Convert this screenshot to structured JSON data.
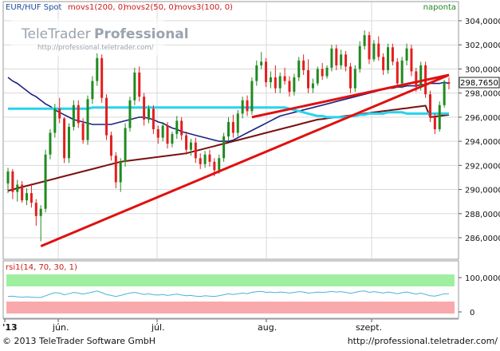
{
  "header": {
    "instrument": "EUR/HUF Spot",
    "ma1": "movs1(200, 0)",
    "ma2": "movs2(50, 0)",
    "ma3": "movs3(100, 0)",
    "period": "naponta"
  },
  "watermark": {
    "brand_light": "TeleTrader",
    "brand_bold": "Professional",
    "url": "http://professional.teletrader.com/"
  },
  "colors": {
    "up_candle": "#1f8a1f",
    "down_candle": "#e41e1e",
    "trendline": "#e01010",
    "ma_navy": "#1a2380",
    "ma_cyan": "#27d3ec",
    "ma_maroon": "#7a1010",
    "grid": "#d9d9d9",
    "rsi_line": "#46b6d4",
    "rsi_overbought": "#9ef0a0",
    "rsi_oversold": "#f9a9ab"
  },
  "price_axis": {
    "ticks": [
      "304,0000",
      "302,0000",
      "300,0000",
      "298,0000",
      "296,0000",
      "294,0000",
      "292,0000",
      "290,0000",
      "288,0000",
      "286,0000"
    ],
    "last_value": "298,7650"
  },
  "rsi": {
    "label": "rsi1(14, 70, 30, 1)",
    "ticks": [
      "100,0000",
      "0"
    ]
  },
  "x_axis": {
    "labels": [
      "'13",
      "jún.",
      "júl.",
      "aug.",
      "szept."
    ]
  },
  "footer": {
    "copyright": "© 2013 TeleTrader Software GmbH",
    "url": "http://professional.teletrader.com/"
  },
  "chart_data": {
    "type": "candlestick",
    "ylim": [
      284,
      305
    ],
    "candles_ohlc": [
      [
        290.5,
        291.8,
        289.7,
        291.5
      ],
      [
        291.5,
        291.7,
        289.2,
        289.8
      ],
      [
        289.8,
        290.8,
        289.0,
        290.4
      ],
      [
        290.4,
        290.7,
        288.9,
        289.1
      ],
      [
        289.1,
        290.1,
        288.7,
        289.7
      ],
      [
        289.7,
        290.5,
        288.5,
        288.9
      ],
      [
        288.9,
        289.2,
        287.0,
        287.8
      ],
      [
        287.8,
        288.7,
        285.7,
        288.4
      ],
      [
        288.4,
        293.3,
        288.1,
        292.9
      ],
      [
        292.9,
        295.0,
        292.5,
        294.7
      ],
      [
        294.7,
        297.1,
        294.3,
        296.7
      ],
      [
        296.7,
        297.6,
        295.5,
        295.9
      ],
      [
        295.9,
        296.0,
        292.2,
        292.6
      ],
      [
        292.6,
        295.5,
        292.2,
        295.2
      ],
      [
        295.2,
        297.4,
        294.9,
        297.0
      ],
      [
        297.0,
        297.4,
        295.1,
        295.5
      ],
      [
        295.5,
        295.9,
        293.8,
        294.1
      ],
      [
        294.1,
        297.8,
        293.7,
        297.5
      ],
      [
        297.5,
        299.4,
        297.1,
        299.0
      ],
      [
        299.0,
        301.3,
        298.6,
        300.9
      ],
      [
        300.9,
        301.2,
        297.2,
        297.6
      ],
      [
        297.6,
        297.9,
        294.1,
        294.5
      ],
      [
        294.5,
        294.8,
        292.4,
        292.8
      ],
      [
        292.8,
        293.1,
        290.1,
        290.6
      ],
      [
        290.6,
        292.6,
        289.8,
        292.3
      ],
      [
        292.3,
        295.5,
        291.9,
        295.1
      ],
      [
        295.1,
        297.7,
        294.8,
        297.4
      ],
      [
        297.4,
        300.1,
        297.0,
        299.7
      ],
      [
        299.7,
        300.2,
        297.3,
        297.7
      ],
      [
        297.7,
        298.0,
        295.3,
        295.8
      ],
      [
        295.8,
        297.0,
        295.5,
        296.7
      ],
      [
        296.7,
        297.0,
        294.6,
        295.0
      ],
      [
        295.0,
        295.3,
        293.8,
        294.3
      ],
      [
        294.3,
        295.6,
        294.0,
        295.3
      ],
      [
        295.3,
        295.6,
        293.4,
        293.8
      ],
      [
        293.8,
        294.8,
        293.5,
        294.6
      ],
      [
        294.6,
        296.1,
        294.2,
        295.7
      ],
      [
        295.7,
        296.0,
        294.1,
        294.5
      ],
      [
        294.5,
        294.8,
        292.9,
        293.3
      ],
      [
        293.3,
        294.2,
        292.8,
        293.9
      ],
      [
        293.9,
        294.3,
        292.2,
        292.6
      ],
      [
        292.6,
        293.0,
        291.7,
        292.1
      ],
      [
        292.1,
        293.2,
        291.8,
        292.9
      ],
      [
        292.9,
        293.3,
        291.9,
        292.3
      ],
      [
        292.3,
        292.6,
        291.1,
        291.6
      ],
      [
        291.6,
        292.9,
        291.3,
        292.6
      ],
      [
        292.6,
        294.7,
        292.3,
        294.4
      ],
      [
        294.4,
        296.0,
        294.0,
        295.6
      ],
      [
        295.6,
        296.2,
        294.3,
        294.7
      ],
      [
        294.7,
        296.6,
        294.4,
        296.3
      ],
      [
        296.3,
        297.7,
        295.9,
        297.4
      ],
      [
        297.4,
        297.8,
        296.1,
        296.5
      ],
      [
        296.5,
        299.3,
        296.2,
        299.0
      ],
      [
        299.0,
        300.7,
        298.6,
        300.3
      ],
      [
        300.3,
        301.4,
        300.0,
        300.6
      ],
      [
        300.6,
        300.9,
        298.5,
        298.9
      ],
      [
        298.9,
        299.8,
        298.4,
        299.3
      ],
      [
        299.3,
        300.3,
        298.0,
        298.4
      ],
      [
        298.4,
        299.7,
        298.0,
        299.4
      ],
      [
        299.4,
        300.1,
        298.7,
        299.0
      ],
      [
        299.0,
        299.4,
        297.7,
        298.1
      ],
      [
        298.1,
        299.6,
        297.8,
        299.3
      ],
      [
        299.3,
        301.0,
        299.0,
        300.7
      ],
      [
        300.7,
        301.2,
        299.5,
        299.9
      ],
      [
        299.9,
        300.8,
        298.0,
        298.4
      ],
      [
        298.4,
        299.2,
        298.0,
        298.8
      ],
      [
        298.8,
        300.2,
        298.6,
        300.0
      ],
      [
        300.0,
        300.5,
        299.1,
        299.4
      ],
      [
        299.4,
        300.3,
        299.2,
        300.1
      ],
      [
        300.1,
        302.0,
        299.8,
        301.7
      ],
      [
        301.7,
        302.0,
        299.9,
        300.3
      ],
      [
        300.3,
        301.6,
        300.0,
        301.2
      ],
      [
        301.2,
        301.5,
        299.8,
        300.2
      ],
      [
        300.2,
        300.5,
        298.0,
        298.4
      ],
      [
        298.4,
        300.3,
        298.1,
        300.0
      ],
      [
        300.0,
        302.3,
        299.7,
        301.9
      ],
      [
        301.9,
        303.2,
        301.6,
        302.8
      ],
      [
        302.8,
        303.1,
        300.4,
        300.8
      ],
      [
        300.8,
        302.4,
        300.6,
        302.1
      ],
      [
        302.1,
        302.7,
        300.7,
        301.0
      ],
      [
        301.0,
        301.3,
        299.5,
        299.9
      ],
      [
        299.9,
        302.1,
        299.6,
        301.8
      ],
      [
        301.8,
        302.1,
        300.3,
        300.6
      ],
      [
        300.6,
        300.9,
        298.5,
        298.8
      ],
      [
        298.8,
        301.0,
        298.4,
        300.7
      ],
      [
        300.7,
        302.1,
        300.3,
        301.7
      ],
      [
        301.7,
        302.0,
        299.4,
        299.8
      ],
      [
        299.8,
        300.1,
        298.1,
        298.5
      ],
      [
        298.5,
        300.6,
        298.2,
        300.3
      ],
      [
        300.3,
        300.6,
        297.6,
        297.9
      ],
      [
        297.9,
        298.2,
        295.6,
        296.0
      ],
      [
        296.0,
        296.3,
        294.6,
        295.0
      ],
      [
        295.0,
        297.3,
        294.8,
        297.0
      ],
      [
        297.0,
        299.1,
        296.8,
        298.9
      ],
      [
        298.9,
        299.3,
        298.3,
        298.8
      ]
    ],
    "trendlines": [
      {
        "from": [
          7,
          285.3
        ],
        "to": [
          94,
          299.5
        ]
      },
      {
        "from": [
          52,
          296.0
        ],
        "to": [
          94,
          299.5
        ]
      }
    ],
    "moving_averages": [
      {
        "name": "movs1(200, 0)",
        "color": "#7a1010",
        "values": [
          289.9,
          290.0,
          290.1,
          290.2,
          290.3,
          290.4,
          290.5,
          290.6,
          290.7,
          290.8,
          290.9,
          291.0,
          291.1,
          291.2,
          291.3,
          291.4,
          291.5,
          291.6,
          291.7,
          291.8,
          291.9,
          292.0,
          292.1,
          292.2,
          292.3,
          292.35,
          292.4,
          292.45,
          292.5,
          292.55,
          292.6,
          292.65,
          292.7,
          292.75,
          292.8,
          292.85,
          292.9,
          292.95,
          293.0,
          293.1,
          293.2,
          293.3,
          293.4,
          293.5,
          293.6,
          293.7,
          293.8,
          293.9,
          294.0,
          294.1,
          294.2,
          294.3,
          294.4,
          294.5,
          294.6,
          294.7,
          294.8,
          294.9,
          295.0,
          295.1,
          295.2,
          295.3,
          295.4,
          295.5,
          295.6,
          295.7,
          295.8,
          295.85,
          295.9,
          295.95,
          296.0,
          296.05,
          296.1,
          296.15,
          296.2,
          296.25,
          296.3,
          296.35,
          296.4,
          296.45,
          296.5,
          296.55,
          296.6,
          296.65,
          296.7,
          296.75,
          296.8,
          296.85,
          296.9,
          296.95,
          296.0,
          296.05,
          296.1,
          296.15,
          296.2
        ]
      },
      {
        "name": "movs2(50, 0)",
        "color": "#1a2380",
        "values": [
          299.3,
          299.0,
          298.8,
          298.5,
          298.2,
          297.9,
          297.7,
          297.4,
          297.1,
          296.9,
          296.6,
          296.4,
          296.2,
          296.0,
          295.8,
          295.7,
          295.6,
          295.5,
          295.4,
          295.4,
          295.4,
          295.4,
          295.4,
          295.5,
          295.6,
          295.7,
          295.8,
          295.9,
          296.0,
          296.0,
          295.9,
          295.8,
          295.6,
          295.5,
          295.3,
          295.1,
          295.0,
          294.8,
          294.7,
          294.6,
          294.5,
          294.4,
          294.3,
          294.2,
          294.1,
          294.0,
          294.0,
          294.0,
          294.1,
          294.3,
          294.5,
          294.7,
          294.9,
          295.1,
          295.3,
          295.5,
          295.7,
          295.9,
          296.1,
          296.2,
          296.3,
          296.4,
          296.5,
          296.6,
          296.7,
          296.8,
          296.9,
          297.0,
          297.1,
          297.2,
          297.3,
          297.4,
          297.5,
          297.6,
          297.7,
          297.8,
          297.9,
          298.0,
          298.1,
          298.2,
          298.3,
          298.4,
          298.4,
          298.5,
          298.5,
          298.6,
          298.6,
          298.6,
          298.7,
          298.7,
          298.8,
          298.8,
          298.8,
          298.9,
          298.8
        ]
      },
      {
        "name": "movs3(100, 0)",
        "color": "#27d3ec",
        "values": [
          296.7,
          296.7,
          296.7,
          296.7,
          296.7,
          296.7,
          296.7,
          296.7,
          296.7,
          296.7,
          296.7,
          296.7,
          296.7,
          296.7,
          296.7,
          296.7,
          296.7,
          296.7,
          296.8,
          296.8,
          296.8,
          296.8,
          296.8,
          296.8,
          296.8,
          296.8,
          296.8,
          296.8,
          296.8,
          296.8,
          296.8,
          296.8,
          296.8,
          296.8,
          296.8,
          296.8,
          296.8,
          296.8,
          296.8,
          296.8,
          296.8,
          296.8,
          296.8,
          296.8,
          296.8,
          296.8,
          296.8,
          296.8,
          296.8,
          296.8,
          296.8,
          296.8,
          296.8,
          296.8,
          296.8,
          296.8,
          296.8,
          296.8,
          296.8,
          296.8,
          296.7,
          296.6,
          296.5,
          296.4,
          296.3,
          296.2,
          296.1,
          296.1,
          296.0,
          296.0,
          296.0,
          296.0,
          296.0,
          296.1,
          296.1,
          296.2,
          296.2,
          296.3,
          296.3,
          296.3,
          296.3,
          296.4,
          296.4,
          296.4,
          296.4,
          296.3,
          296.3,
          296.3,
          296.3,
          296.3,
          296.3,
          296.3,
          296.3,
          296.3,
          296.3
        ]
      }
    ],
    "rsi_values": [
      45,
      46,
      44,
      43,
      44,
      43,
      42,
      42,
      47,
      52,
      56,
      55,
      50,
      53,
      57,
      55,
      52,
      55,
      58,
      61,
      56,
      51,
      48,
      45,
      48,
      52,
      55,
      57,
      54,
      51,
      53,
      50,
      49,
      51,
      48,
      50,
      52,
      49,
      47,
      48,
      46,
      45,
      47,
      46,
      45,
      47,
      50,
      53,
      51,
      53,
      55,
      53,
      57,
      59,
      60,
      57,
      58,
      56,
      58,
      57,
      55,
      57,
      59,
      58,
      55,
      56,
      58,
      57,
      58,
      60,
      58,
      59,
      57,
      54,
      57,
      60,
      61,
      57,
      59,
      57,
      55,
      58,
      56,
      53,
      56,
      58,
      55,
      52,
      55,
      51,
      47,
      46,
      49,
      53,
      53
    ],
    "rsi_scale": [
      0,
      100
    ]
  }
}
